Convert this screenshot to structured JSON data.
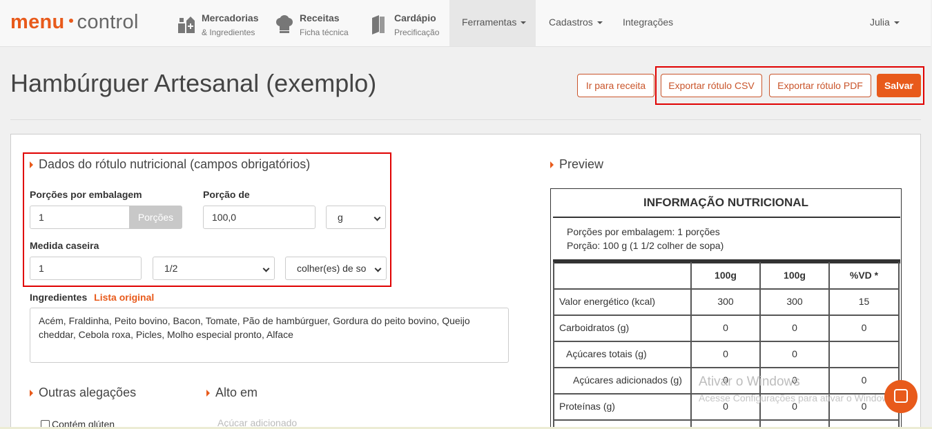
{
  "nav": {
    "logo_part1": "menu",
    "logo_part2": "control",
    "items": [
      {
        "title": "Mercadorias",
        "subtitle": "& Ingredientes",
        "icon": "ingredients-icon"
      },
      {
        "title": "Receitas",
        "subtitle": "Ficha técnica",
        "icon": "chef-hat-icon"
      },
      {
        "title": "Cardápio",
        "subtitle": "Precificação",
        "icon": "menu-book-icon"
      }
    ],
    "ferramentas": "Ferramentas",
    "cadastros": "Cadastros",
    "integracoes": "Integrações",
    "user": "Julia"
  },
  "header": {
    "title": "Hambúrguer Artesanal (exemplo)",
    "btn_receita": "Ir para receita",
    "btn_csv": "Exportar rótulo CSV",
    "btn_pdf": "Exportar rótulo PDF",
    "btn_save": "Salvar"
  },
  "form": {
    "section_title": "Dados do rótulo nutricional (campos obrigatórios)",
    "porcoes_label": "Porções por embalagem",
    "porcoes_value": "1",
    "porcoes_addon": "Porções",
    "porcao_label": "Porção de",
    "porcao_value": "100,0",
    "porcao_unit": "g",
    "medida_label": "Medida caseira",
    "medida_value": "1",
    "medida_fraction": "1/2",
    "medida_unit": "colher(es) de so",
    "ingredientes_label": "Ingredientes",
    "lista_original": "Lista original",
    "ingredientes_text": "Acém, Fraldinha, Peito bovino, Bacon, Tomate, Pão de hambúrguer, Gordura do peito bovino, Queijo cheddar, Cebola roxa, Picles, Molho especial pronto, Alface",
    "outras_title": "Outras alegações",
    "alto_title": "Alto em",
    "gluten_label": "Contém glúten",
    "acucar_label": "Açúcar adicionado"
  },
  "preview": {
    "title": "Preview",
    "nut_title": "INFORMAÇÃO NUTRICIONAL",
    "porcoes_line": "Porções por embalagem: 1 porções",
    "porcao_line": "Porção: 100 g (1 1/2 colher de sopa)",
    "col_headers": [
      "100g",
      "100g",
      "%VD *"
    ],
    "rows": [
      {
        "name": "Valor energético (kcal)",
        "v1": "300",
        "v2": "300",
        "vd": "15"
      },
      {
        "name": "Carboidratos (g)",
        "v1": "0",
        "v2": "0",
        "vd": "0"
      },
      {
        "name": "Açúcares totais (g)",
        "v1": "0",
        "v2": "0",
        "vd": ""
      },
      {
        "name": "Açúcares adicionados (g)",
        "v1": "0",
        "v2": "0",
        "vd": "0"
      },
      {
        "name": "Proteínas (g)",
        "v1": "0",
        "v2": "0",
        "vd": "0"
      }
    ]
  },
  "overlay": {
    "watermark_title": "Ativar o Windows",
    "watermark_sub": "Acesse Configurações para ativar o Windows."
  },
  "colors": {
    "accent": "#e85a1b",
    "highlight": "#e00000"
  }
}
